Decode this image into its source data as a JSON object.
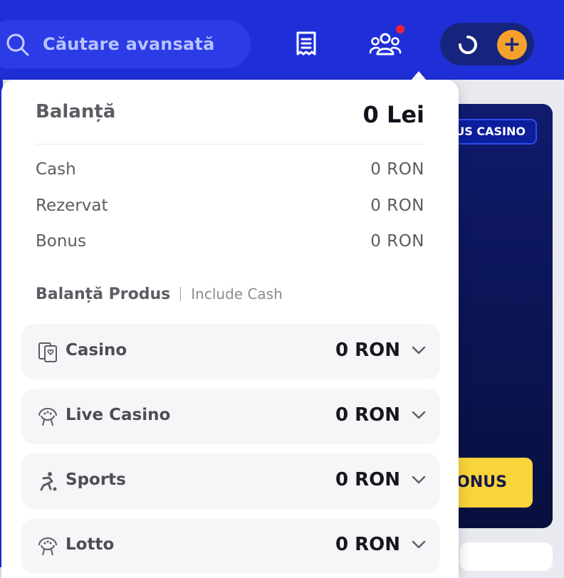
{
  "header": {
    "search_placeholder": "Căutare avansată",
    "accent_color": "#1f2fd8",
    "wallet_plus": "+",
    "icons": [
      "search-icon",
      "receipt-icon",
      "users-icon",
      "spinner-icon",
      "plus-icon"
    ]
  },
  "background": {
    "promo_badge": "NUS CASINO",
    "bonus_button": "BONUS"
  },
  "balance": {
    "title": "Balanță",
    "total": "0 Lei",
    "rows": [
      {
        "label": "Cash",
        "value": "0 RON"
      },
      {
        "label": "Rezervat",
        "value": "0 RON"
      },
      {
        "label": "Bonus",
        "value": "0 RON"
      }
    ],
    "product_title": "Balanță Produs",
    "product_subtitle": "Include Cash",
    "products": [
      {
        "label": "Casino",
        "value": "0 RON",
        "icon": "casino-cards-icon"
      },
      {
        "label": "Live Casino",
        "value": "0 RON",
        "icon": "roulette-icon"
      },
      {
        "label": "Sports",
        "value": "0 RON",
        "icon": "soccer-player-icon"
      },
      {
        "label": "Lotto",
        "value": "0 RON",
        "icon": "lotto-icon"
      }
    ]
  }
}
